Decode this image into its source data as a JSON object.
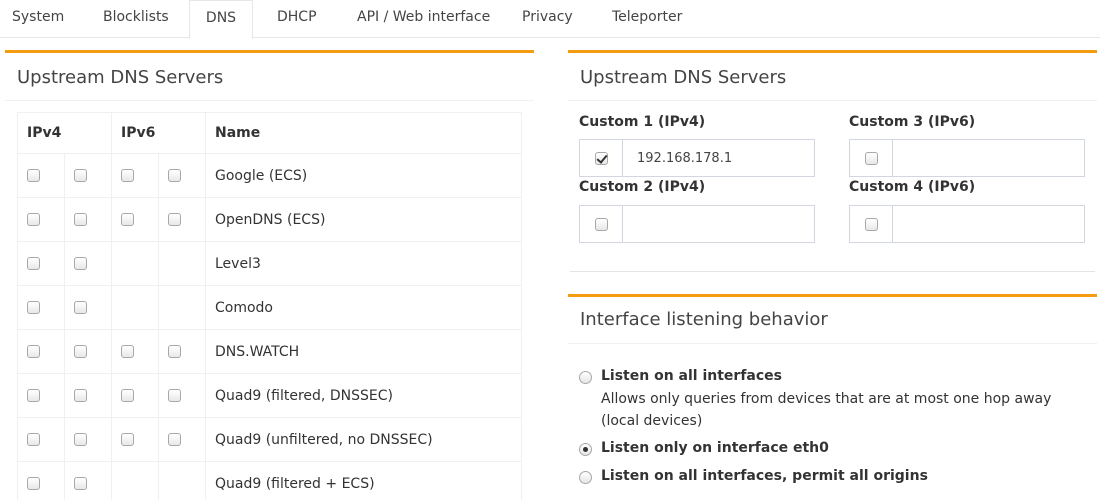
{
  "tabs": [
    {
      "label": "System"
    },
    {
      "label": "Blocklists"
    },
    {
      "label": "DNS"
    },
    {
      "label": "DHCP"
    },
    {
      "label": "API / Web interface"
    },
    {
      "label": "Privacy"
    },
    {
      "label": "Teleporter"
    }
  ],
  "active_tab": "DNS",
  "accent_color": "#f39c12",
  "left_panel": {
    "title": "Upstream DNS Servers",
    "headers": {
      "ipv4": "IPv4",
      "ipv6": "IPv6",
      "name": "Name"
    },
    "servers": [
      {
        "name": "Google (ECS)",
        "ipv4": [
          false,
          false
        ],
        "ipv6": [
          false,
          false
        ],
        "has_ipv6": true
      },
      {
        "name": "OpenDNS (ECS)",
        "ipv4": [
          false,
          false
        ],
        "ipv6": [
          false,
          false
        ],
        "has_ipv6": true
      },
      {
        "name": "Level3",
        "ipv4": [
          false,
          false
        ],
        "ipv6": [],
        "has_ipv6": false
      },
      {
        "name": "Comodo",
        "ipv4": [
          false,
          false
        ],
        "ipv6": [],
        "has_ipv6": false
      },
      {
        "name": "DNS.WATCH",
        "ipv4": [
          false,
          false
        ],
        "ipv6": [
          false,
          false
        ],
        "has_ipv6": true
      },
      {
        "name": "Quad9 (filtered, DNSSEC)",
        "ipv4": [
          false,
          false
        ],
        "ipv6": [
          false,
          false
        ],
        "has_ipv6": true
      },
      {
        "name": "Quad9 (unfiltered, no DNSSEC)",
        "ipv4": [
          false,
          false
        ],
        "ipv6": [
          false,
          false
        ],
        "has_ipv6": true
      },
      {
        "name": "Quad9 (filtered + ECS)",
        "ipv4": [
          false,
          false
        ],
        "ipv6": [],
        "has_ipv6": false
      }
    ]
  },
  "right_panel": {
    "title": "Upstream DNS Servers",
    "custom": [
      {
        "label": "Custom 1 (IPv4)",
        "checked": true,
        "value": "192.168.178.1"
      },
      {
        "label": "Custom 2 (IPv4)",
        "checked": false,
        "value": ""
      },
      {
        "label": "Custom 3 (IPv6)",
        "checked": false,
        "value": ""
      },
      {
        "label": "Custom 4 (IPv6)",
        "checked": false,
        "value": ""
      }
    ]
  },
  "interface_panel": {
    "title": "Interface listening behavior",
    "options": [
      {
        "label": "Listen on all interfaces",
        "description": "Allows only queries from devices that are at most one hop away (local devices)",
        "selected": false
      },
      {
        "label": "Listen only on interface eth0",
        "description": "",
        "selected": true
      },
      {
        "label": "Listen on all interfaces, permit all origins",
        "description": "",
        "selected": false
      }
    ]
  }
}
